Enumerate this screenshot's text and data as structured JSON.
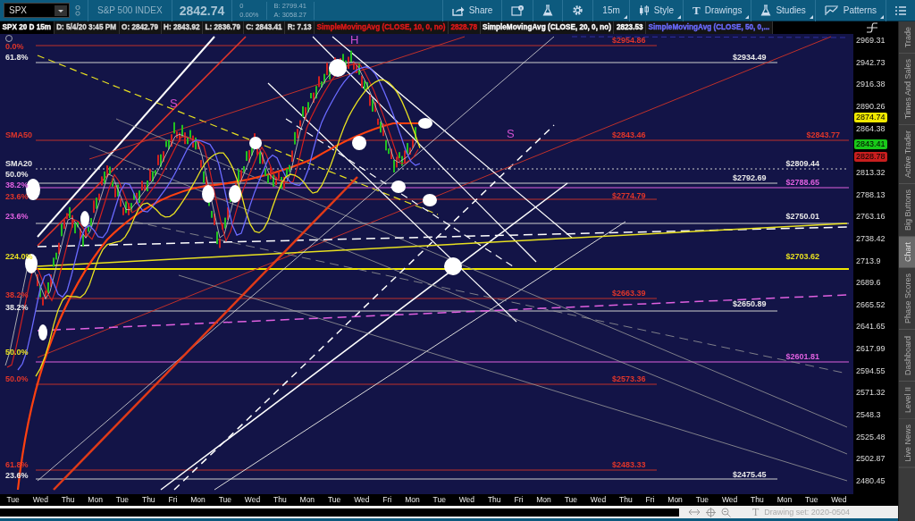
{
  "toolbar": {
    "symbol": "SPX",
    "description": "S&P 500 INDEX",
    "last": "2842.74",
    "change": "0",
    "change_percent": "0.00%",
    "bid": "B: 2799.41",
    "ask": "A: 3058.27",
    "buttons": [
      {
        "kind": "share",
        "label": "Share",
        "has_menu": false
      },
      {
        "kind": "info",
        "has_menu": false
      },
      {
        "kind": "flask",
        "has_menu": false
      },
      {
        "kind": "gear",
        "has_menu": false
      },
      {
        "kind": "text",
        "label": "15m",
        "has_menu": true
      },
      {
        "kind": "candles",
        "label": "Style",
        "has_menu": true
      },
      {
        "kind": "glyph",
        "icon": "T",
        "label": "Drawings",
        "has_menu": true
      },
      {
        "kind": "flask",
        "label": "Studies",
        "has_menu": true
      },
      {
        "kind": "pattern",
        "label": "Patterns",
        "has_menu": true
      },
      {
        "kind": "list",
        "has_menu": false
      }
    ]
  },
  "legend": {
    "title": "SPX 20 D 15m",
    "fields": [
      "D: 5/4/20 3:45 PM",
      "O: 2842.79",
      "H: 2843.92",
      "L: 2836.79",
      "C: 2843.41",
      "R: 7.13"
    ],
    "studies": [
      {
        "text": "SimpleMovingAvg (CLOSE, 10, 0, no)",
        "value": "2828.78"
      },
      {
        "text": "SimpleMovingAvg (CLOSE, 20, 0, no)",
        "value": "2823.53"
      },
      {
        "text": "SimpleMovingAvg (CLOSE, 50, 0,..."
      }
    ]
  },
  "chart": {
    "letters": [
      {
        "text": "S"
      },
      {
        "text": "H"
      },
      {
        "text": "S"
      }
    ],
    "fib_labels": [
      {
        "text": "0.0%",
        "color": "#e0352a"
      },
      {
        "text": "61.8%",
        "color": "#e8e8e8"
      },
      {
        "text": "SMA50",
        "color": "#e0352a"
      },
      {
        "text": "SMA20",
        "color": "#e8e8e8"
      },
      {
        "text": "50.0%",
        "color": "#e8e8e8"
      },
      {
        "text": "38.2%",
        "color": "#e060e0"
      },
      {
        "text": "23.6%",
        "color": "#e0352a"
      },
      {
        "text": "23.6%",
        "color": "#e060e0"
      },
      {
        "text": "224.0%",
        "color": "#e8e020"
      },
      {
        "text": "38.2%",
        "color": "#e0352a"
      },
      {
        "text": "38.2%",
        "color": "#e8e8e8"
      },
      {
        "text": "50.0%",
        "color": "#e8e020"
      },
      {
        "text": "50.0%",
        "color": "#e0352a"
      },
      {
        "text": "61.8%",
        "color": "#e0352a"
      },
      {
        "text": "23.6%",
        "color": "#e8e8e8"
      }
    ],
    "price_labels": [
      {
        "text": "$2954.86",
        "color": "#e0352a"
      },
      {
        "text": "$2934.49",
        "color": "#e8e8e8"
      },
      {
        "text": "$2843.46",
        "color": "#e0352a"
      },
      {
        "text": "$2843.77",
        "color": "#e0352a"
      },
      {
        "text": "$2809.44",
        "color": "#e8e8e8"
      },
      {
        "text": "$2792.69",
        "color": "#e8e8e8"
      },
      {
        "text": "$2788.65",
        "color": "#e060e0"
      },
      {
        "text": "$2774.79",
        "color": "#e0352a"
      },
      {
        "text": "$2750.01",
        "color": "#e8e8e8"
      },
      {
        "text": "$2703.62",
        "color": "#e8e020"
      },
      {
        "text": "$2663.39",
        "color": "#e0352a"
      },
      {
        "text": "$2650.89",
        "color": "#e8e8e8"
      },
      {
        "text": "$2601.81",
        "color": "#e060e0"
      },
      {
        "text": "$2573.36",
        "color": "#e0352a"
      },
      {
        "text": "$2483.33",
        "color": "#e0352a"
      },
      {
        "text": "$2475.45",
        "color": "#e8e8e8"
      }
    ]
  },
  "price_axis": {
    "ticks": [
      "2969.31",
      "2942.73",
      "2916.38",
      "2890.26",
      "2864.38",
      "2813.32",
      "2788.13",
      "2763.16",
      "2738.42",
      "2713.9",
      "2689.6",
      "2665.52",
      "2641.65",
      "2617.99",
      "2594.55",
      "2571.32",
      "2548.3",
      "2525.48",
      "2502.87",
      "2480.45"
    ],
    "badges": [
      {
        "text": "2874.74",
        "color": "#f0e800"
      },
      {
        "text": "2843.41",
        "color": "#19c819"
      },
      {
        "text": "2828.78",
        "color": "#c81e1e"
      }
    ]
  },
  "time_axis": {
    "labels": [
      "Tue",
      "Wed",
      "Thu",
      "Mon",
      "Tue",
      "Thu",
      "Fri",
      "Mon",
      "Tue",
      "Wed",
      "Thu",
      "Mon",
      "Tue",
      "Wed",
      "Fri",
      "Mon",
      "Tue",
      "Wed",
      "Thu",
      "Fri",
      "Mon",
      "Tue",
      "Wed",
      "Thu",
      "Fri",
      "Mon",
      "Tue",
      "Wed",
      "Thu",
      "Mon",
      "Tue",
      "Wed"
    ]
  },
  "footer": {
    "icon_text": "T",
    "drawing_set": "Drawing set: 2020-0504"
  },
  "side_tabs": [
    {
      "label": "Trade",
      "selected": false
    },
    {
      "label": "Times And Sales",
      "selected": false
    },
    {
      "label": "Active Trader",
      "selected": false
    },
    {
      "label": "Big Buttons",
      "selected": false
    },
    {
      "label": "Chart",
      "selected": true
    },
    {
      "label": "Phase Scores",
      "selected": false
    },
    {
      "label": "Dashboard",
      "selected": false
    },
    {
      "label": "Level II",
      "selected": false
    },
    {
      "label": "Live News",
      "selected": false
    }
  ]
}
